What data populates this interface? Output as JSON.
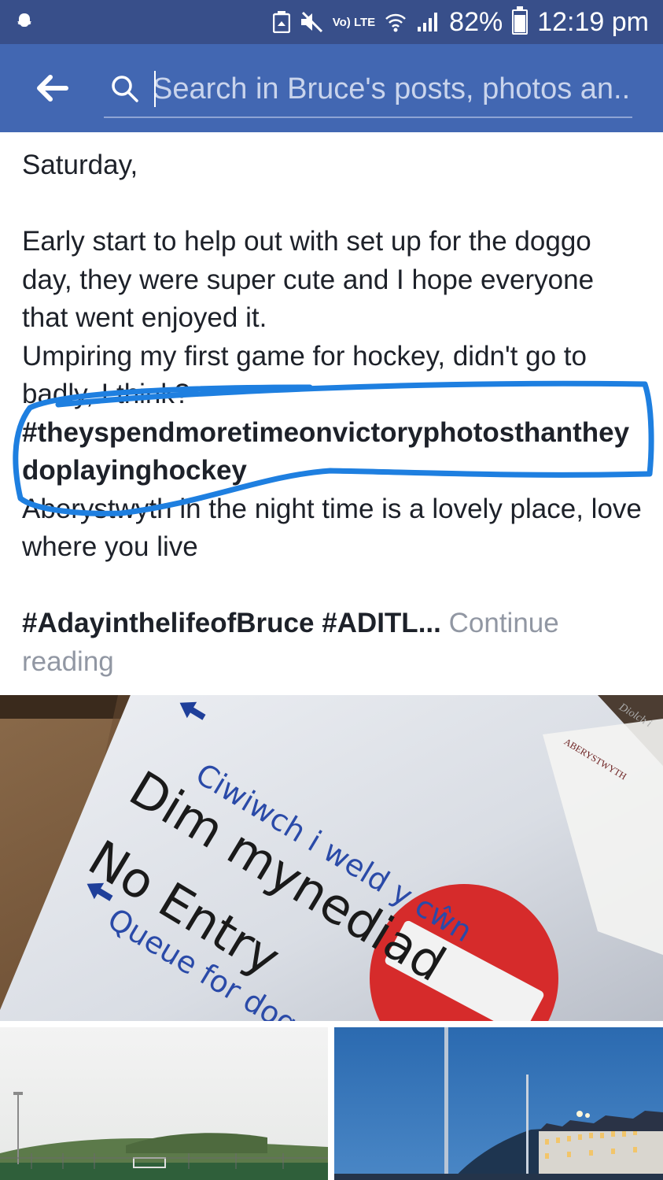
{
  "status_bar": {
    "battery": "82%",
    "time": "12:19 pm",
    "network_label": "Vo) LTE",
    "icons": [
      "snapchat-icon",
      "storage-icon",
      "mute-icon",
      "volte-icon",
      "wifi-icon",
      "signal-icon",
      "battery-icon"
    ]
  },
  "header": {
    "search_placeholder": "Search in Bruce's posts, photos an..."
  },
  "post": {
    "line1": "Saturday,",
    "para1": "Early start to help out with set up for the doggo day, they were super cute and I hope everyone that went enjoyed it.",
    "para2": "Umpiring my first game for hockey, didn't go to badly, I think?",
    "hashtag_highlight": "#theyspendmoretimeonvictoryphotosthantheydoplayinghockey",
    "para3": "Aberystwyth in the night time is a lovely place, love where you live",
    "hashtags_line": "#AdayinthelifeofBruce #ADITL...",
    "continue_reading": "Continue reading"
  },
  "photo_sign": {
    "line1": "Ciwiwch i weld y cŵn",
    "line2": "Dim mynediad",
    "line3": "No Entry",
    "line4": "Queue for dogs",
    "logo_text": "ABERYSTWYTH",
    "corner_text": "Diolch i"
  },
  "colors": {
    "status_bar": "#384f8a",
    "header": "#4267b2",
    "annotation": "#1e7fe0",
    "text": "#1d2129",
    "muted": "#9197a3"
  }
}
